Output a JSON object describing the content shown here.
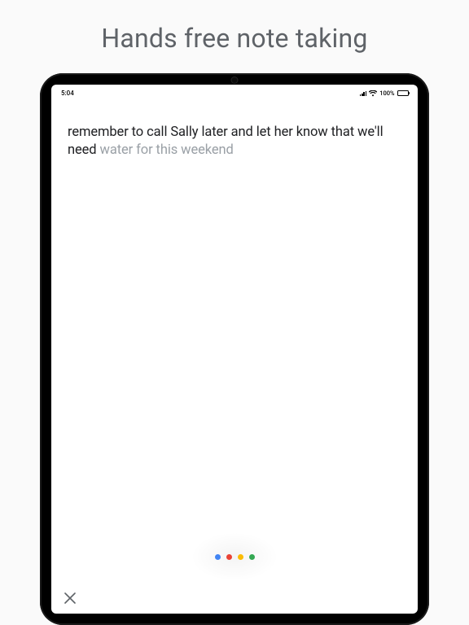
{
  "headline": "Hands free note taking",
  "status": {
    "time": "5:04",
    "battery_pct": "100%"
  },
  "note": {
    "confirmed": "remember to call Sally later and let her know that we'll need ",
    "pending": "water for this weekend"
  },
  "colors": {
    "dot1": "#4285F4",
    "dot2": "#EA4335",
    "dot3": "#FBBC04",
    "dot4": "#34A853"
  }
}
